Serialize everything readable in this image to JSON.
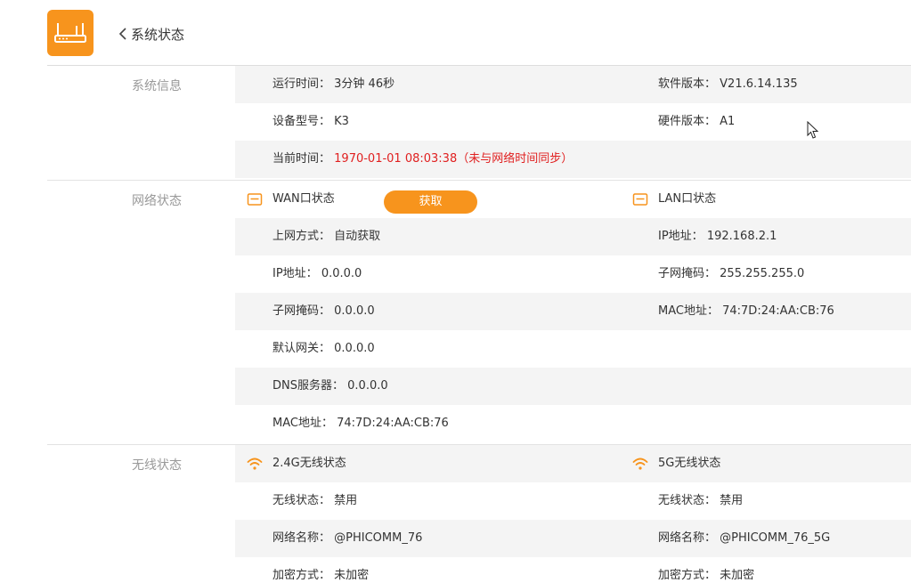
{
  "header": {
    "title": "系统状态",
    "logo_icon": "router-icon",
    "back_icon": "chevron-left-icon",
    "accent_color": "#f7941d"
  },
  "system_info": {
    "label": "系统信息",
    "uptime_label": "运行时间：",
    "uptime": "3分钟 46秒",
    "software_version_label": "软件版本：",
    "software_version": "V21.6.14.135",
    "model_label": "设备型号：",
    "model": "K3",
    "hardware_version_label": "硬件版本：",
    "hardware_version": "A1",
    "current_time_label": "当前时间：",
    "current_time": "1970-01-01 08:03:38（未与网络时间同步）"
  },
  "network_status": {
    "label": "网络状态",
    "wan": {
      "title": "WAN口状态",
      "fetch_button": "获取",
      "conn_type_label": "上网方式：",
      "conn_type": "自动获取",
      "ip_label": "IP地址：",
      "ip": "0.0.0.0",
      "mask_label": "子网掩码：",
      "mask": "0.0.0.0",
      "gateway_label": "默认网关：",
      "gateway": "0.0.0.0",
      "dns_label": "DNS服务器：",
      "dns": "0.0.0.0",
      "mac_label": "MAC地址：",
      "mac": "74:7D:24:AA:CB:76"
    },
    "lan": {
      "title": "LAN口状态",
      "ip_label": "IP地址：",
      "ip": "192.168.2.1",
      "mask_label": "子网掩码：",
      "mask": "255.255.255.0",
      "mac_label": "MAC地址：",
      "mac": "74:7D:24:AA:CB:76"
    }
  },
  "wireless_status": {
    "label": "无线状态",
    "band24": {
      "title": "2.4G无线状态",
      "state_label": "无线状态：",
      "state": "禁用",
      "ssid_label": "网络名称：",
      "ssid": "@PHICOMM_76",
      "enc_label": "加密方式：",
      "enc": "未加密"
    },
    "band5": {
      "title": "5G无线状态",
      "state_label": "无线状态：",
      "state": "禁用",
      "ssid_label": "网络名称：",
      "ssid": "@PHICOMM_76_5G",
      "enc_label": "加密方式：",
      "enc": "未加密"
    }
  }
}
